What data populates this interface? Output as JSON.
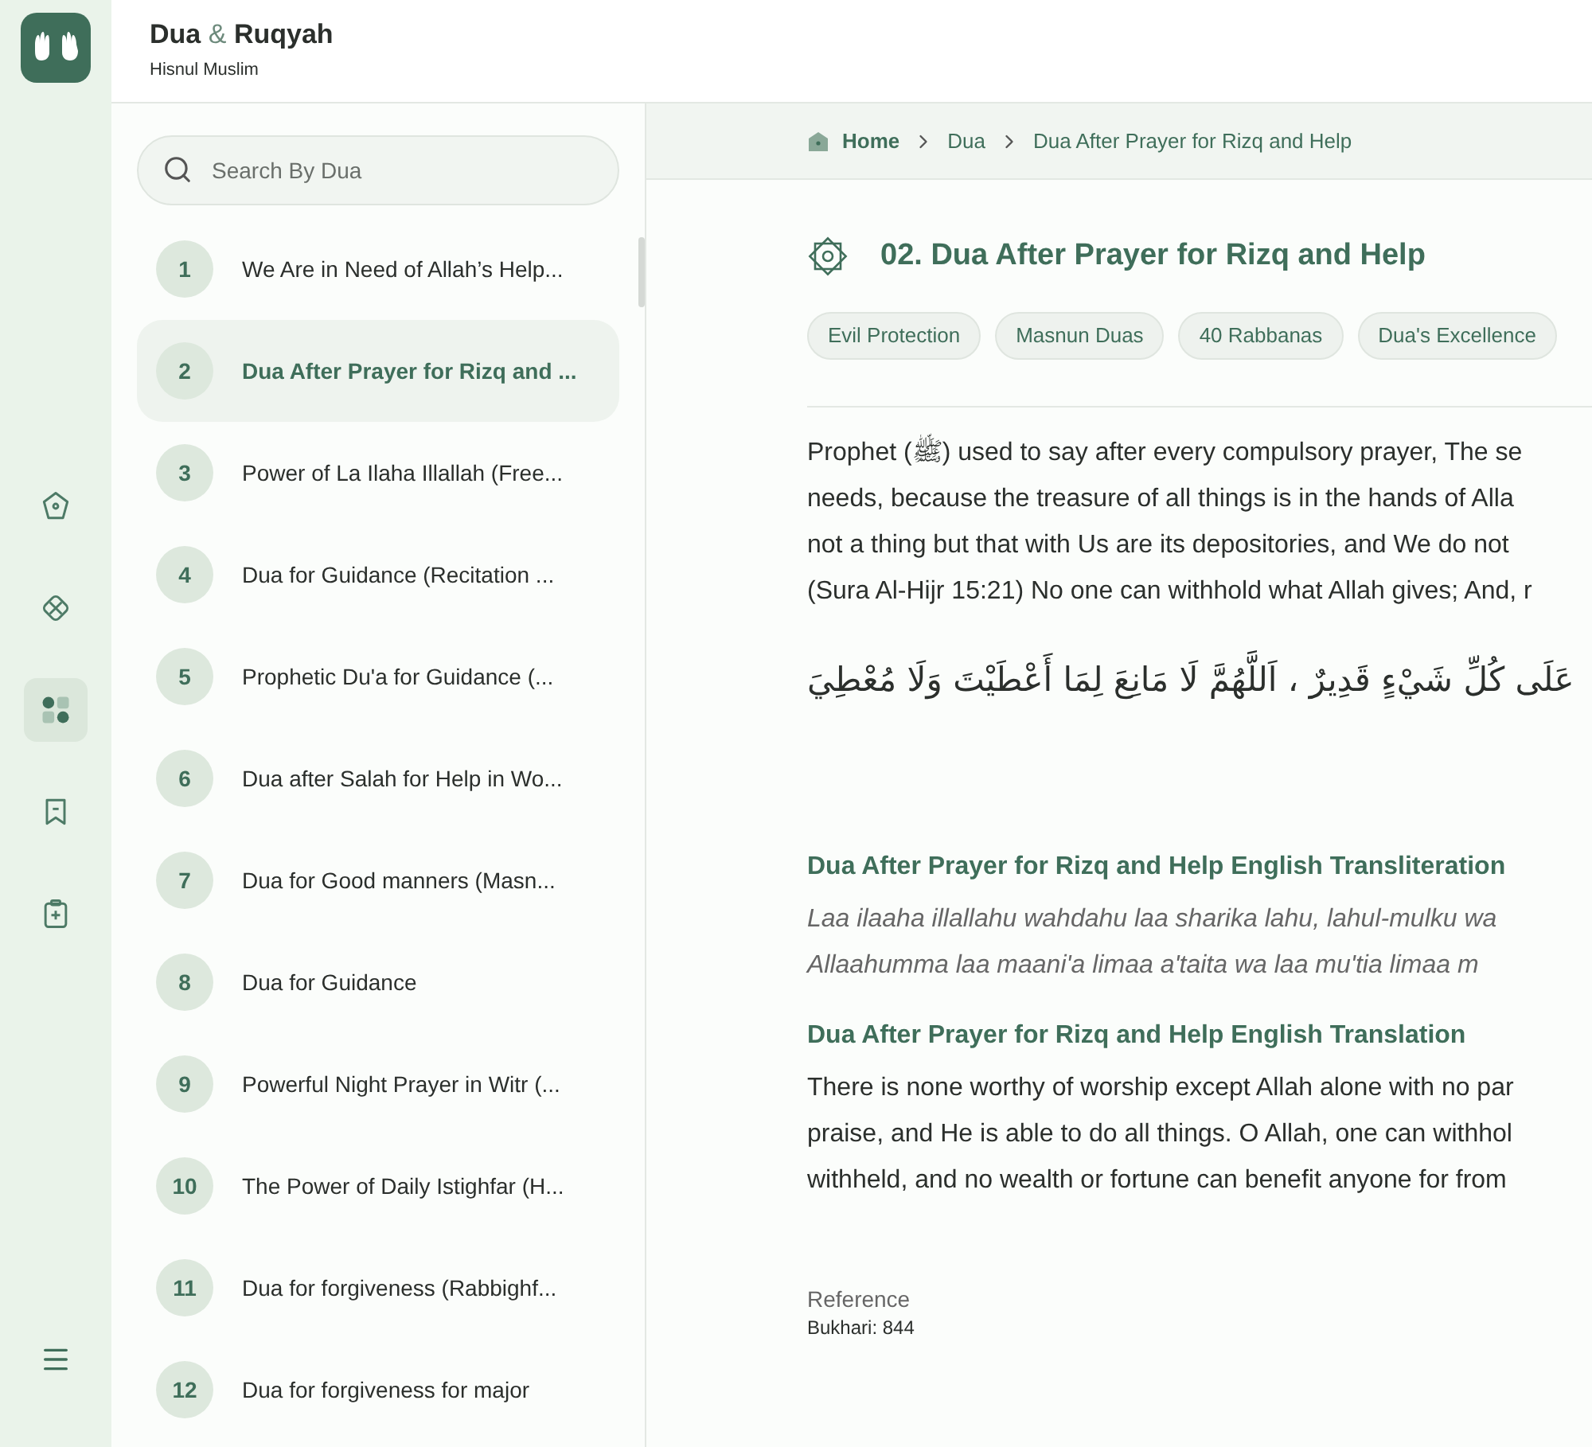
{
  "app": {
    "title_part_1": "Dua",
    "title_amp": "&",
    "title_part_2": "Ruqyah",
    "subtitle": "Hisnul Muslim"
  },
  "rail": [
    {
      "kind": "home",
      "selected": false
    },
    {
      "kind": "diamond",
      "selected": false
    },
    {
      "kind": "dots",
      "selected": true
    },
    {
      "kind": "bookmark",
      "selected": false
    },
    {
      "kind": "clipboard",
      "selected": false
    }
  ],
  "search": {
    "placeholder": "Search By Dua"
  },
  "duas": [
    {
      "number": "1",
      "title": "We Are in Need of Allah’s Help...",
      "selected": false
    },
    {
      "number": "2",
      "title": "Dua After Prayer for Rizq and ...",
      "selected": true
    },
    {
      "number": "3",
      "title": "Power of La Ilaha Illallah (Free...",
      "selected": false
    },
    {
      "number": "4",
      "title": "Dua for Guidance (Recitation ...",
      "selected": false
    },
    {
      "number": "5",
      "title": "Prophetic Du'a for Guidance (...",
      "selected": false
    },
    {
      "number": "6",
      "title": "Dua after Salah for Help in Wo...",
      "selected": false
    },
    {
      "number": "7",
      "title": "Dua for Good manners (Masn...",
      "selected": false
    },
    {
      "number": "8",
      "title": "Dua for Guidance",
      "selected": false
    },
    {
      "number": "9",
      "title": "Powerful Night Prayer in Witr (...",
      "selected": false
    },
    {
      "number": "10",
      "title": "The Power of Daily Istighfar (H...",
      "selected": false
    },
    {
      "number": "11",
      "title": "Dua for forgiveness (Rabbighf...",
      "selected": false
    },
    {
      "number": "12",
      "title": "Dua for forgiveness for major",
      "selected": false
    }
  ],
  "breadcrumb": [
    "Home",
    "Dua",
    "Dua After Prayer for Rizq and Help"
  ],
  "heading": "02. Dua After Prayer for Rizq and Help",
  "tags": [
    "Evil Protection",
    "Masnun Duas",
    "40 Rabbanas",
    "Dua's Excellence"
  ],
  "intro_lines": [
    "Prophet (ﷺ) used to say after every compulsory prayer, The se",
    "needs, because the treasure of all things is in the hands of Alla",
    "not a thing but that with Us are its depositories, and We do not",
    "(Sura Al-Hijr 15:21) No one can withhold what Allah gives; And, r"
  ],
  "arabic": "عَلَى كُلِّ شَيْءٍ قَدِيرٌ ، اَللَّهُمَّ لَا مَانِعَ لِمَا أَعْطَيْتَ وَلَا مُعْطِيَ",
  "transliteration": {
    "heading": "Dua After Prayer for Rizq and Help English Transliteration",
    "lines": [
      "Laa ilaaha illallahu wahdahu laa sharika lahu, lahul-mulku wa",
      "Allaahumma laa maani'a limaa a'taita wa laa mu'tia limaa m"
    ]
  },
  "translation": {
    "heading": "Dua After Prayer for Rizq and Help English Translation",
    "lines": [
      "There is none worthy of worship except Allah alone with no par",
      "praise, and He is able to do all things. O Allah, one can withhol",
      "withheld, and no wealth or fortune can benefit anyone for from"
    ]
  },
  "reference": {
    "label": "Reference",
    "value": "Bukhari: 844"
  }
}
